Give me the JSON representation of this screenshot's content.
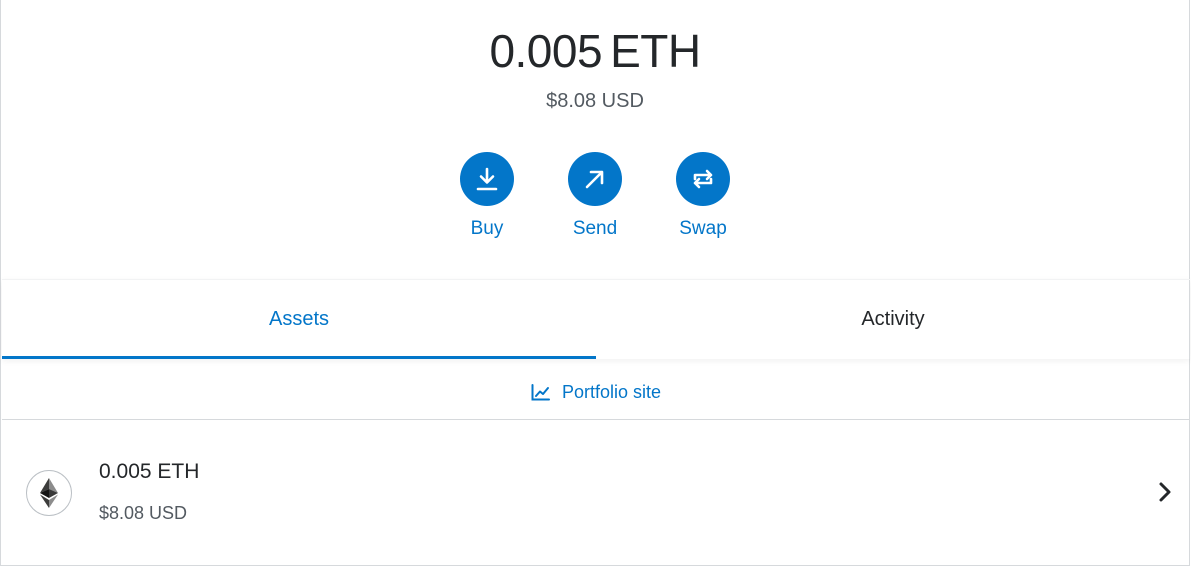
{
  "balance": {
    "amount": "0.005",
    "currency": "ETH",
    "fiat": "$8.08 USD"
  },
  "actions": [
    {
      "label": "Buy",
      "icon": "download-arrow-icon"
    },
    {
      "label": "Send",
      "icon": "arrow-up-right-icon"
    },
    {
      "label": "Swap",
      "icon": "swap-arrows-icon"
    }
  ],
  "tabs": [
    {
      "label": "Assets",
      "active": true
    },
    {
      "label": "Activity",
      "active": false
    }
  ],
  "portfolio_link": {
    "label": "Portfolio site",
    "icon": "chart-icon"
  },
  "assets": [
    {
      "amount": "0.005 ETH",
      "fiat": "$8.08 USD",
      "icon": "ethereum-logo-icon"
    }
  ],
  "colors": {
    "accent": "#0376c9",
    "text": "#24272a",
    "muted": "#535a61",
    "border": "#d6d9dc"
  }
}
